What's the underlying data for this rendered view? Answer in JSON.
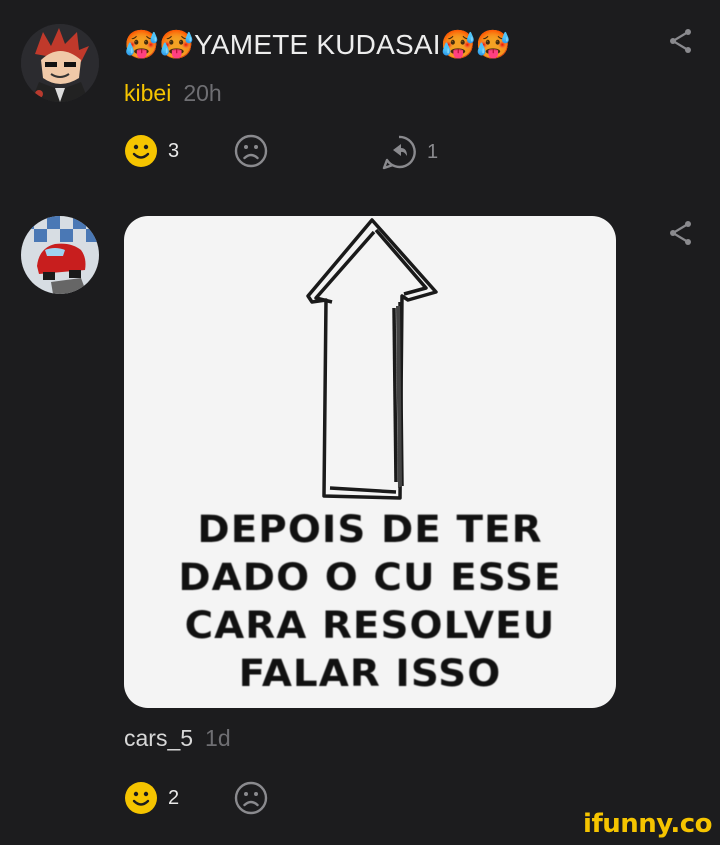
{
  "comments": [
    {
      "text": "🥵🥵YAMETE KUDASAI🥵🥵",
      "username": "kibei",
      "time": "20h",
      "smile_count": "3",
      "reply_count": "1"
    },
    {
      "username": "cars_5",
      "time": "1d",
      "smile_count": "2",
      "meme_lines": [
        "DEPOIS DE TER",
        "DADO O CU ESSE",
        "CARA RESOLVEU",
        "FALAR ISSO"
      ]
    }
  ],
  "watermark": "ifunny.co",
  "colors": {
    "accent": "#f5c400",
    "background": "#1c1c1e",
    "muted": "#6f6f73"
  }
}
